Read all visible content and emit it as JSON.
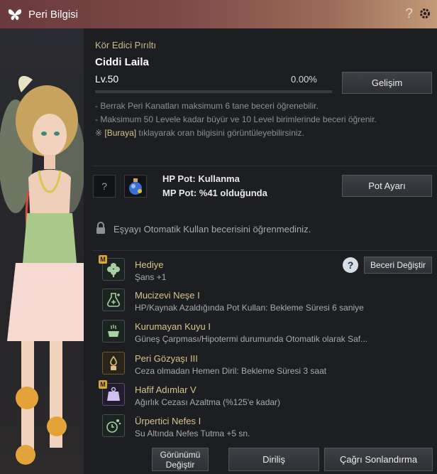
{
  "window": {
    "title": "Peri Bilgisi"
  },
  "header": {
    "skill_name": "Kör Edici Pırıltı",
    "peri_name": "Ciddi Laila",
    "level": "Lv.50",
    "xp_percent": "0.00%",
    "xp_fraction": 0.0
  },
  "buttons": {
    "gelisim": "Gelişim",
    "pot_ayari": "Pot Ayarı",
    "beceri_degistir": "Beceri Değiştir",
    "gorunumu_degistir_1": "Görünümü",
    "gorunumu_degistir_2": "Değiştir",
    "dirilis": "Diriliş",
    "cagri_sonlandirma": "Çağrı Sonlandırma"
  },
  "info": {
    "line1": "- Berrak Peri Kanatları maksimum 6 tane beceri öğrenebilir.",
    "line2": "- Maksimum 50 Levele kadar büyür ve 10 Level birimlerinde beceri öğrenir.",
    "line3_prefix": "※ ",
    "line3_link": "[Buraya]",
    "line3_suffix": " tıklayarak oran bilgisini görüntüleyebilirsiniz."
  },
  "pots": {
    "empty_slot": "?",
    "hp": "HP Pot: Kullanma",
    "mp": "MP Pot: %41 olduğunda"
  },
  "auto_use": {
    "text": "Eşyayı Otomatik Kullan becerisini öğrenmediniz."
  },
  "skill_help": "?",
  "skills": [
    {
      "name": "Hediye",
      "desc": "Şans +1",
      "badge": "M",
      "icon": "clover-icon"
    },
    {
      "name": "Mucizevi Neşe I",
      "desc": "HP/Kaynak Azaldığında Pot Kullan: Bekleme Süresi 6 saniye",
      "badge": "",
      "icon": "potion-plus-icon"
    },
    {
      "name": "Kurumayan Kuyu I",
      "desc": "Güneş Çarpması/Hipotermi durumunda Otomatik olarak Saf...",
      "badge": "",
      "icon": "well-icon"
    },
    {
      "name": "Peri Gözyaşı III",
      "desc": "Ceza olmadan Hemen Diril: Bekleme Süresi 3 saat",
      "badge": "",
      "icon": "tear-vial-icon"
    },
    {
      "name": "Hafif Adımlar V",
      "desc": "Ağırlık Cezası Azaltma (%125'e kadar)",
      "badge": "M",
      "icon": "weight-icon"
    },
    {
      "name": "Ürpertici Nefes I",
      "desc": "Su Altında Nefes Tutma +5 sn.",
      "badge": "",
      "icon": "breath-icon"
    }
  ],
  "colors": {
    "accent": "#d9c38a",
    "title_bar": "#7d4848",
    "panel": "#1d1e22"
  }
}
